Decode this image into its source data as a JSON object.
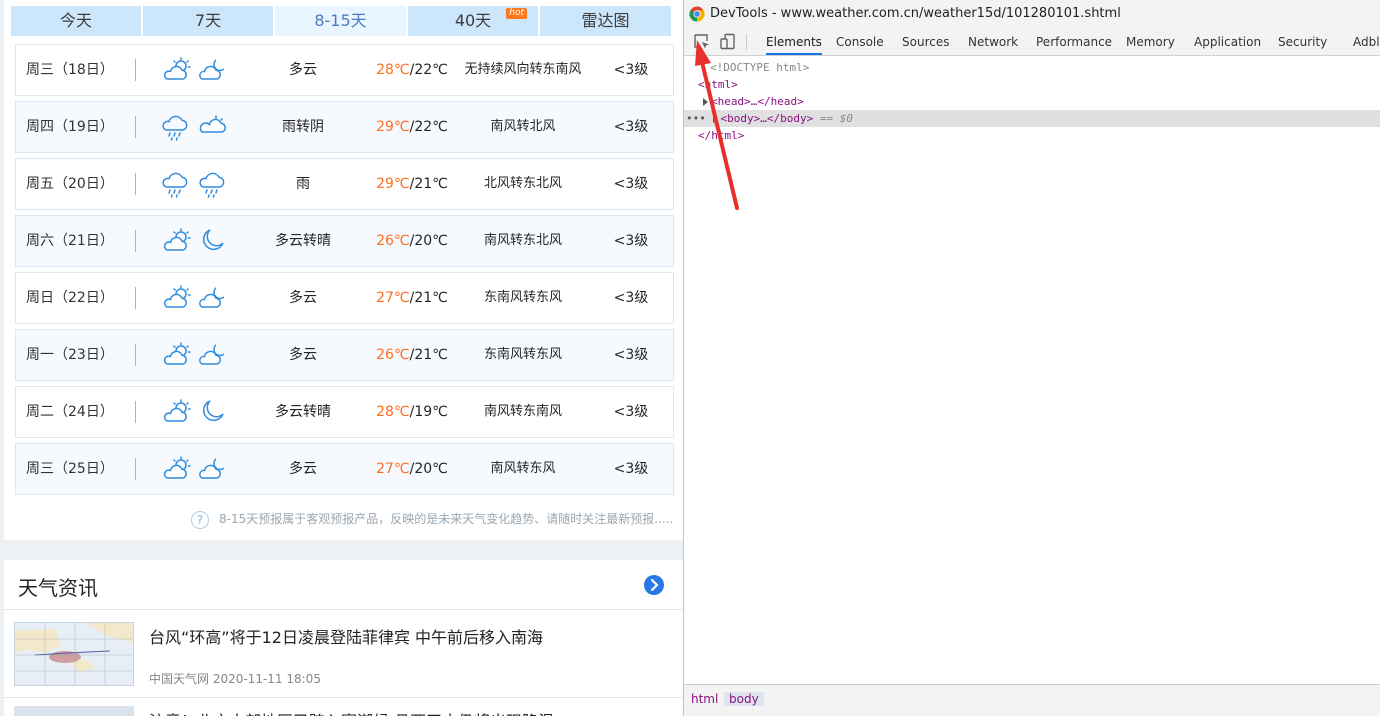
{
  "weather": {
    "tabs": [
      {
        "label": "今天",
        "hot": ""
      },
      {
        "label": "7天",
        "hot": ""
      },
      {
        "label": "8-15天",
        "hot": ""
      },
      {
        "label": "40天",
        "hot": "hot"
      },
      {
        "label": "雷达图",
        "hot": ""
      }
    ],
    "days": [
      {
        "date": "周三（18日）",
        "icon1": "partly-cloudy-day-icon",
        "icon2": "cloudy-night-icon",
        "weather": "多云",
        "high": "28℃",
        "low": "/22℃",
        "wind": "无持续风向转东南风",
        "level": "<3级"
      },
      {
        "date": "周四（19日）",
        "icon1": "rain-icon",
        "icon2": "overcast-night-icon",
        "weather": "雨转阴",
        "high": "29℃",
        "low": "/22℃",
        "wind": "南风转北风",
        "level": "<3级"
      },
      {
        "date": "周五（20日）",
        "icon1": "rain-icon",
        "icon2": "rain-icon",
        "weather": "雨",
        "high": "29℃",
        "low": "/21℃",
        "wind": "北风转东北风",
        "level": "<3级"
      },
      {
        "date": "周六（21日）",
        "icon1": "partly-cloudy-day-icon",
        "icon2": "moon-icon",
        "weather": "多云转晴",
        "high": "26℃",
        "low": "/20℃",
        "wind": "南风转东北风",
        "level": "<3级"
      },
      {
        "date": "周日（22日）",
        "icon1": "partly-cloudy-day-icon",
        "icon2": "cloudy-night-icon",
        "weather": "多云",
        "high": "27℃",
        "low": "/21℃",
        "wind": "东南风转东风",
        "level": "<3级"
      },
      {
        "date": "周一（23日）",
        "icon1": "partly-cloudy-day-icon",
        "icon2": "cloudy-night-icon",
        "weather": "多云",
        "high": "26℃",
        "low": "/21℃",
        "wind": "东南风转东风",
        "level": "<3级"
      },
      {
        "date": "周二（24日）",
        "icon1": "partly-cloudy-day-icon",
        "icon2": "moon-icon",
        "weather": "多云转晴",
        "high": "28℃",
        "low": "/19℃",
        "wind": "南风转东南风",
        "level": "<3级"
      },
      {
        "date": "周三（25日）",
        "icon1": "partly-cloudy-day-icon",
        "icon2": "cloudy-night-icon",
        "weather": "多云",
        "high": "27℃",
        "low": "/20℃",
        "wind": "南风转东风",
        "level": "<3级"
      }
    ],
    "note": "8-15天预报属于客观预报产品，反映的是未来天气变化趋势、请随时关注最新预报.....",
    "note_icon": "?",
    "news_title": "天气资讯",
    "news": [
      {
        "headline": "台风“环高”将于12日凌晨登陆菲律宾 中午前后移入南海",
        "meta": "中国天气网 2020-11-11 18:05"
      },
      {
        "headline": "注意！北方大部地区已跨入寒潮候 且两天内仍将出现降温"
      }
    ]
  },
  "devtools": {
    "title": "DevTools - www.weather.com.cn/weather15d/101280101.shtml",
    "tabs": [
      "Elements",
      "Console",
      "Sources",
      "Network",
      "Performance",
      "Memory",
      "Application",
      "Security",
      "Adblo"
    ],
    "active_tab": "Elements",
    "dom": {
      "doctype": "<!DOCTYPE html>",
      "html_open": "<html>",
      "head": "<head>…</head>",
      "body": "<body>…</body>",
      "body_eq": "== $0",
      "html_close": "</html>",
      "dots": "•••"
    },
    "crumbs": [
      "html",
      "body"
    ],
    "arrow_color": "#e8302a",
    "accent": "#1a73e8"
  }
}
